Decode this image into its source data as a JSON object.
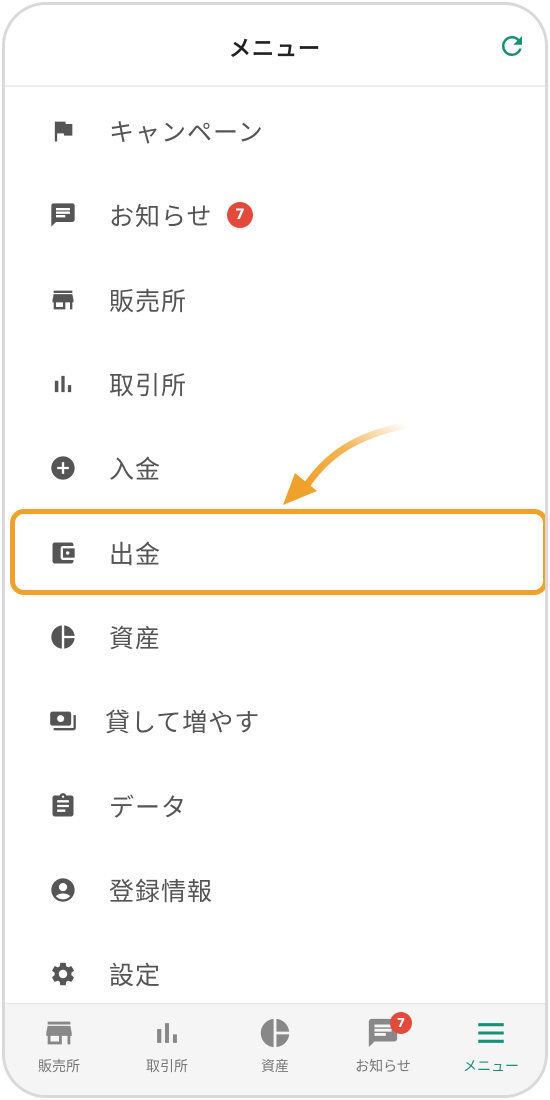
{
  "header": {
    "title": "メニュー",
    "refresh_icon": "refresh-icon"
  },
  "menu": {
    "items": [
      {
        "label": "キャンペーン",
        "icon": "flag-icon"
      },
      {
        "label": "お知らせ",
        "icon": "message-icon",
        "badge": "7"
      },
      {
        "label": "販売所",
        "icon": "store-icon"
      },
      {
        "label": "取引所",
        "icon": "bar-chart-icon"
      },
      {
        "label": "入金",
        "icon": "plus-circle-icon"
      },
      {
        "label": "出金",
        "icon": "wallet-icon",
        "highlighted": true
      },
      {
        "label": "資産",
        "icon": "pie-chart-icon"
      },
      {
        "label": "貸して増やす",
        "icon": "money-icon"
      },
      {
        "label": "データ",
        "icon": "clipboard-icon"
      },
      {
        "label": "登録情報",
        "icon": "account-icon"
      },
      {
        "label": "設定",
        "icon": "gear-icon"
      }
    ]
  },
  "tabbar": {
    "tabs": [
      {
        "label": "販売所",
        "icon": "store-icon"
      },
      {
        "label": "取引所",
        "icon": "bar-chart-icon"
      },
      {
        "label": "資産",
        "icon": "pie-chart-icon"
      },
      {
        "label": "お知らせ",
        "icon": "message-icon",
        "badge": "7"
      },
      {
        "label": "メニュー",
        "icon": "hamburger-menu-icon",
        "active": true
      }
    ]
  },
  "colors": {
    "accent": "#1a8f78",
    "highlight": "#f0a12b",
    "badge": "#e24a3b",
    "icon": "#555555"
  }
}
